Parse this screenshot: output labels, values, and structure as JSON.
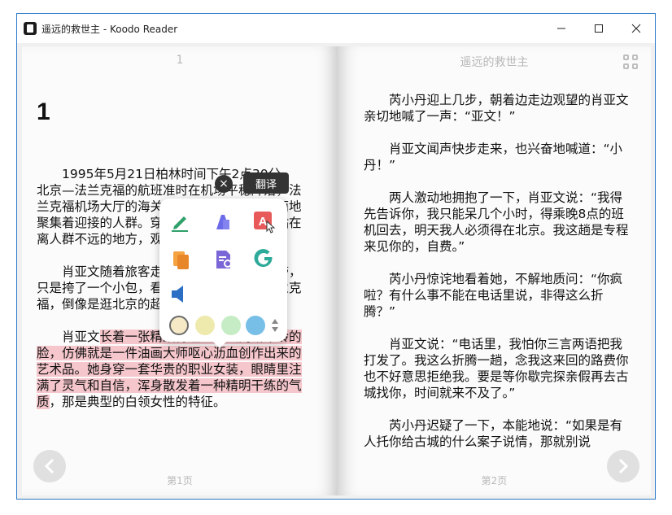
{
  "window": {
    "title": "遥远的救世主 - Koodo Reader",
    "minimize_icon": "minimize-icon",
    "maximize_icon": "maximize-icon",
    "close_icon": "close-icon"
  },
  "left_page": {
    "header": "1",
    "chapter_title": "1",
    "paragraphs": [
      "1995年5月21日柏林时间下午2点30分，北京—法兰克福的航班准时在机场平稳降落，法兰克福机场大厅的海关检查口处走出三三两两地聚集着迎接的人群。穿着时尚风衣的芮小丹站在离人群不远的地方，观看着依次而出的旅客。",
      "肖亚文随着旅客走出来，没有行李也没带，只是挎了一个小包，看她那情形不像是来法兰克福，倒像是逛北京的超市。"
    ],
    "highlight_para": {
      "pre": "肖亚文",
      "highlighted": "长着一张精致得让人无法判断年龄的脸，仿佛就是一件油画大师呕心沥血创作出来的艺术品。她身穿一套华贵的职业女装，眼睛里注满了灵气和自信，浑身散发着一种精明干练的气质",
      "post": "，那是典型的白领女性的特征。"
    },
    "footer": "第1页"
  },
  "right_page": {
    "header": "遥远的救世主",
    "paragraphs": [
      "芮小丹迎上几步，朝着边走边观望的肖亚文亲切地喊了一声：“亚文！”",
      "肖亚文闻声快步走来，也兴奋地喊道：“小丹！”",
      "两人激动地拥抱了一下，肖亚文说：“我得先告诉你，我只能呆几个小时，得乘晚8点的班机回去，明天我人必须得在北京。我这趟是专程来见你的，自费。”",
      "芮小丹惊诧地看着她，不解地质问：“你疯啦？有什么事不能在电话里说，非得这么折腾？”",
      "肖亚文说：“电话里，我怕你三言两语把我打发了。我这么折腾一趟，念我这来回的路费你也不好意思拒绝我。要是等你歇完探亲假再去古城找你，时间就来不及了。”",
      "芮小丹迟疑了一下，本能地说：“如果是有人托你给古城的什么案子说情，那就别说"
    ],
    "footer": "第2页"
  },
  "popup": {
    "tooltip": "翻译",
    "close_label": "×",
    "tools": [
      "note-pen-icon",
      "highlight-icon",
      "translate-icon",
      "copy-icon",
      "search-doc-icon",
      "google-icon",
      "speak-icon"
    ],
    "colors": [
      "#f6e9c6",
      "#eeeaad",
      "#c6ecc6",
      "#78bfe8"
    ]
  },
  "nav": {
    "prev_icon": "chevron-left-icon",
    "next_icon": "chevron-right-icon"
  }
}
